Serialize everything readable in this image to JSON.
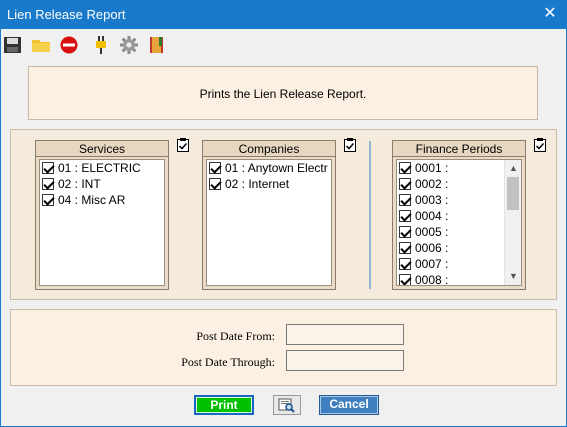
{
  "window": {
    "title": "Lien Release Report",
    "close_glyph": "✕"
  },
  "toolbar": {
    "icons": [
      "save-icon",
      "open-folder-icon",
      "stop-icon",
      "plug-icon",
      "gear-icon",
      "report-book-icon"
    ]
  },
  "header": {
    "text": "Prints the Lien Release Report."
  },
  "services": {
    "title": "Services",
    "items": [
      {
        "label": "01 : ELECTRIC",
        "checked": true
      },
      {
        "label": "02 : INT",
        "checked": true
      },
      {
        "label": "04 : Misc AR",
        "checked": true
      }
    ]
  },
  "companies": {
    "title": "Companies",
    "items": [
      {
        "label": "01 : Anytown Electr",
        "checked": true
      },
      {
        "label": "02 : Internet",
        "checked": true
      }
    ]
  },
  "finance_periods": {
    "title": "Finance Periods",
    "items": [
      {
        "label": "0001 :",
        "checked": true
      },
      {
        "label": "0002 :",
        "checked": true
      },
      {
        "label": "0003 :",
        "checked": true
      },
      {
        "label": "0004 :",
        "checked": true
      },
      {
        "label": "0005 :",
        "checked": true
      },
      {
        "label": "0006 :",
        "checked": true
      },
      {
        "label": "0007 :",
        "checked": true
      },
      {
        "label": "0008 :",
        "checked": true
      }
    ]
  },
  "dates": {
    "from_label": "Post Date From:",
    "from_value": "",
    "through_label": "Post Date Through:",
    "through_value": ""
  },
  "buttons": {
    "print": "Print",
    "cancel": "Cancel"
  },
  "colors": {
    "title_bar": "#1979ca",
    "panel_bg": "#fbf0e2",
    "print_button": "#00c000",
    "cancel_button": "#3f7fc0"
  }
}
